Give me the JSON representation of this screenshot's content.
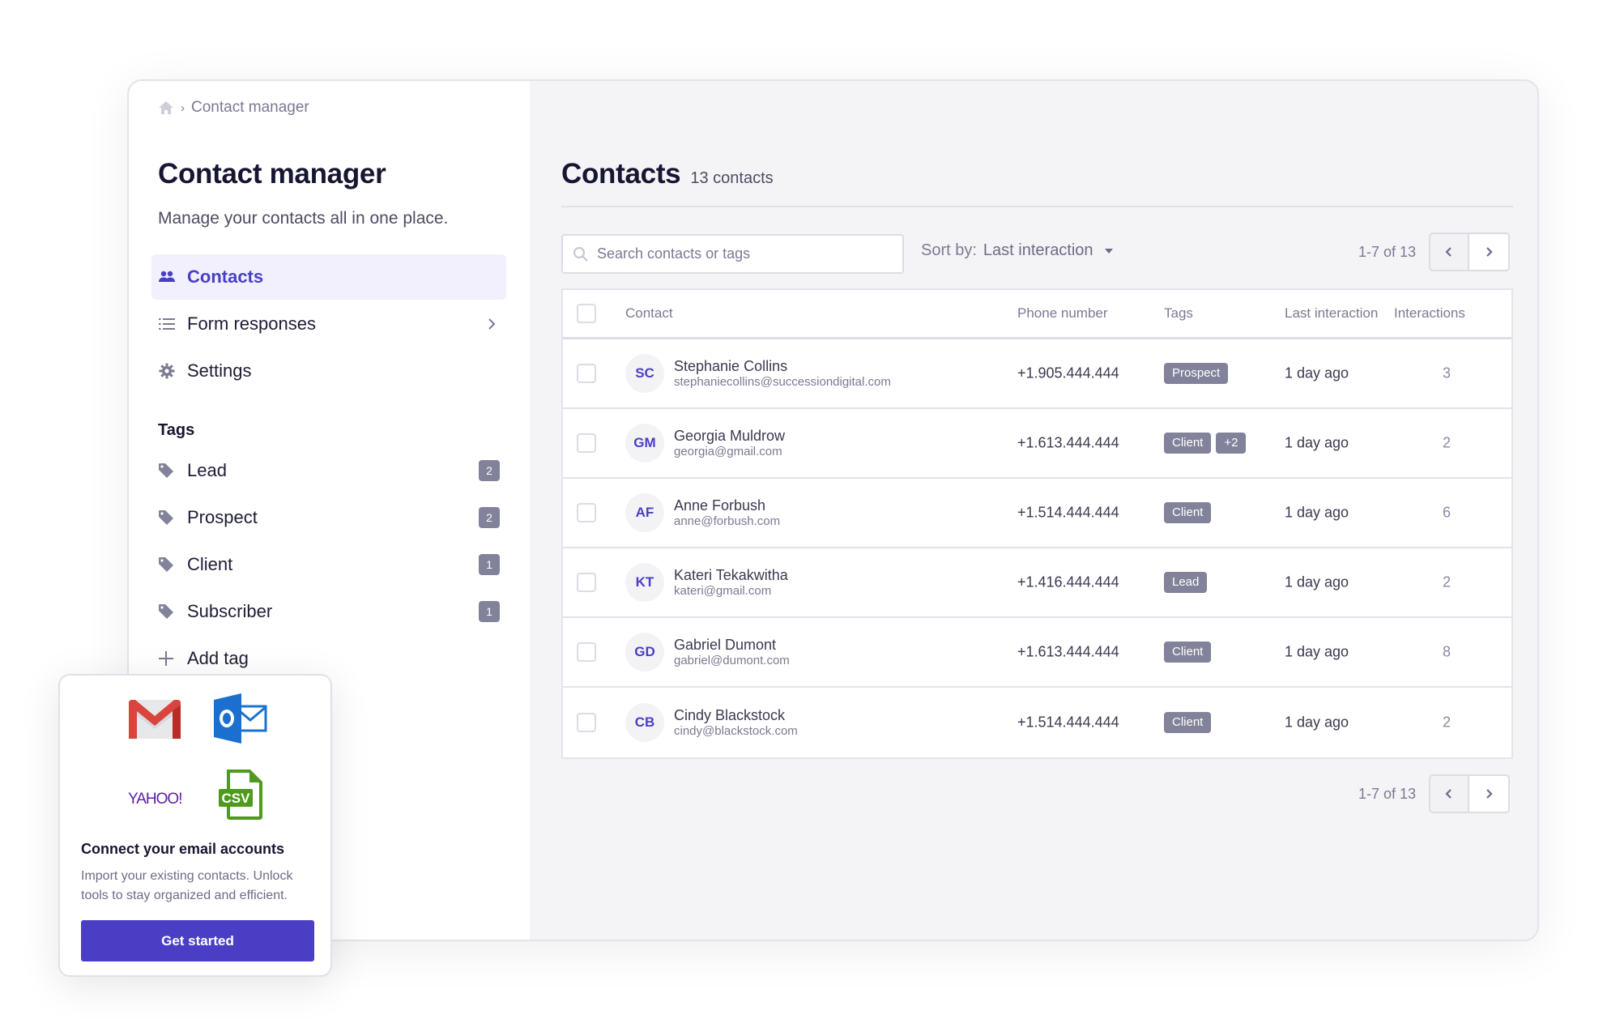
{
  "breadcrumb": {
    "home_icon": "home-icon",
    "current": "Contact manager"
  },
  "sidebar": {
    "title": "Contact manager",
    "subtitle": "Manage your contacts all in one place.",
    "nav": [
      {
        "label": "Contacts",
        "icon": "people-icon",
        "active": true
      },
      {
        "label": "Form responses",
        "icon": "list-icon",
        "has_chevron": true
      },
      {
        "label": "Settings",
        "icon": "gear-icon"
      }
    ],
    "tags_heading": "Tags",
    "tags": [
      {
        "label": "Lead",
        "count": "2"
      },
      {
        "label": "Prospect",
        "count": "2"
      },
      {
        "label": "Client",
        "count": "1"
      },
      {
        "label": "Subscriber",
        "count": "1"
      }
    ],
    "add_tag_label": "Add tag"
  },
  "main": {
    "title": "Contacts",
    "count_label": "13 contacts",
    "search": {
      "placeholder": "Search contacts or tags",
      "value": ""
    },
    "sort": {
      "label": "Sort by:",
      "value": "Last interaction"
    },
    "pagination": {
      "range": "1-7 of 13"
    },
    "table": {
      "columns": [
        "Contact",
        "Phone number",
        "Tags",
        "Last interaction",
        "Interactions"
      ],
      "rows": [
        {
          "initials": "SC",
          "name": "Stephanie Collins",
          "email": "stephaniecollins@successiondigital.com",
          "phone": "+1.905.444.444",
          "tags": [
            "Prospect"
          ],
          "last": "1 day ago",
          "interactions": "3"
        },
        {
          "initials": "GM",
          "name": "Georgia Muldrow",
          "email": "georgia@gmail.com",
          "phone": "+1.613.444.444",
          "tags": [
            "Client",
            "+2"
          ],
          "last": "1 day ago",
          "interactions": "2"
        },
        {
          "initials": "AF",
          "name": "Anne Forbush",
          "email": "anne@forbush.com",
          "phone": "+1.514.444.444",
          "tags": [
            "Client"
          ],
          "last": "1 day ago",
          "interactions": "6"
        },
        {
          "initials": "KT",
          "name": "Kateri Tekakwitha",
          "email": "kateri@gmail.com",
          "phone": "+1.416.444.444",
          "tags": [
            "Lead"
          ],
          "last": "1 day ago",
          "interactions": "2"
        },
        {
          "initials": "GD",
          "name": "Gabriel Dumont",
          "email": "gabriel@dumont.com",
          "phone": "+1.613.444.444",
          "tags": [
            "Client"
          ],
          "last": "1 day ago",
          "interactions": "8"
        },
        {
          "initials": "CB",
          "name": "Cindy Blackstock",
          "email": "cindy@blackstock.com",
          "phone": "+1.514.444.444",
          "tags": [
            "Client"
          ],
          "last": "1 day ago",
          "interactions": "2"
        }
      ]
    }
  },
  "card": {
    "logos": [
      "gmail-logo",
      "outlook-logo",
      "yahoo-logo",
      "csv-file-icon"
    ],
    "yahoo_text": "YAHOO!",
    "csv_text": "CSV",
    "title": "Connect your email accounts",
    "description": "Import your existing contacts. Unlock tools to stay organized and efficient.",
    "button_label": "Get started"
  },
  "colors": {
    "accent": "#4a3fc4",
    "tag_pill": "#82829a",
    "active_nav_bg": "#f1f0fc",
    "main_bg": "#f4f4f7"
  }
}
